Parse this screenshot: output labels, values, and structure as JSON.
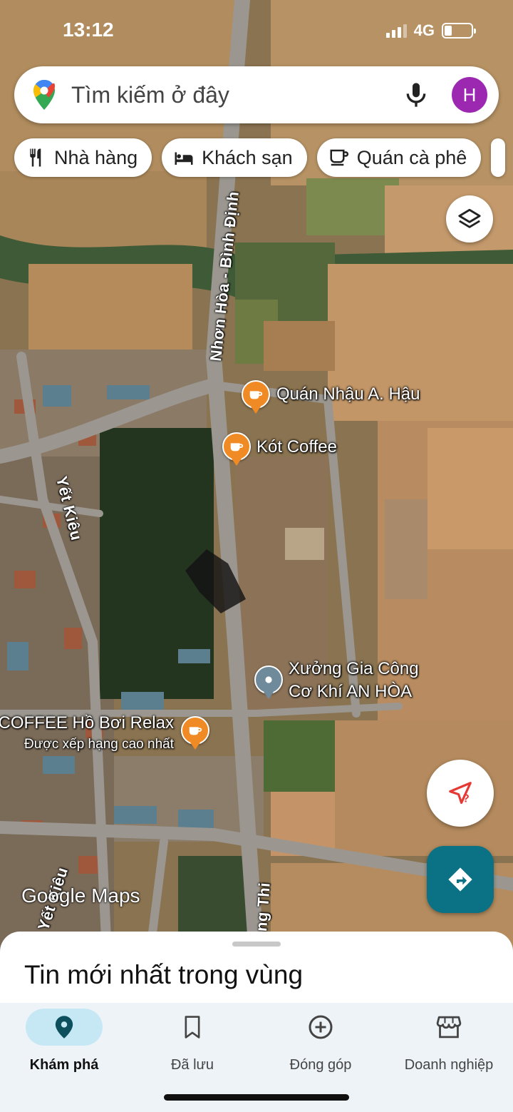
{
  "status_bar": {
    "time": "13:12",
    "network": "4G"
  },
  "search": {
    "placeholder": "Tìm kiếm ở đây",
    "avatar_letter": "H"
  },
  "chips": [
    {
      "label": "Nhà hàng",
      "icon": "restaurant-icon"
    },
    {
      "label": "Khách sạn",
      "icon": "hotel-icon"
    },
    {
      "label": "Quán cà phê",
      "icon": "coffee-icon"
    }
  ],
  "map": {
    "roads": {
      "nhon_hoa": "Nhơn Hòa - Bình Định",
      "yet_kieu_1": "Yết Kiêu",
      "yet_kieu_2": "Yết Kiêu",
      "bottom_road": "ng Thi"
    },
    "pois": {
      "quan_nhau": "Quán Nhậu A. Hậu",
      "kot_coffee": "Kót Coffee",
      "xuong_line1": "Xưởng Gia Công",
      "xuong_line2": "Cơ Khí AN HÒA",
      "relax": "COFFEE Hồ Bơi Relax",
      "relax_sub": "Được xếp hạng cao nhất"
    },
    "watermark": "Google Maps"
  },
  "sheet": {
    "title": "Tin mới nhất trong vùng"
  },
  "nav": [
    {
      "label": "Khám phá",
      "icon": "explore-pin-icon",
      "active": true
    },
    {
      "label": "Đã lưu",
      "icon": "bookmark-icon",
      "active": false
    },
    {
      "label": "Đóng góp",
      "icon": "add-circle-icon",
      "active": false
    },
    {
      "label": "Doanh nghiệp",
      "icon": "storefront-icon",
      "active": false
    }
  ],
  "colors": {
    "accent": "#0b7285",
    "poi_orange": "#f08a24",
    "avatar": "#9c27b0",
    "nav_bg": "#eef3f8",
    "active_pill": "#c5e8f4"
  }
}
